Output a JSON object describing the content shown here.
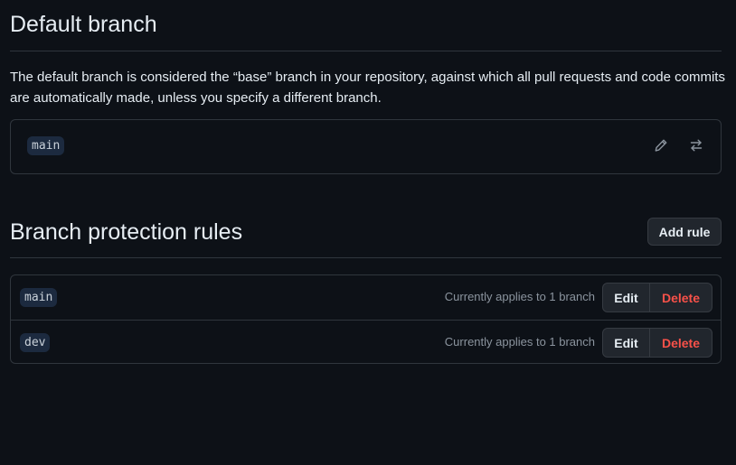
{
  "default_branch": {
    "title": "Default branch",
    "description": "The default branch is considered the “base” branch in your repository, against which all pull requests and code commits are automatically made, unless you specify a different branch.",
    "branch_name": "main",
    "edit_icon": "pencil-icon",
    "switch_icon": "arrow-switch-icon"
  },
  "protection": {
    "title": "Branch protection rules",
    "add_rule_label": "Add rule",
    "rules": [
      {
        "branch": "main",
        "applies_text": "Currently applies to 1 branch",
        "edit_label": "Edit",
        "delete_label": "Delete"
      },
      {
        "branch": "dev",
        "applies_text": "Currently applies to 1 branch",
        "edit_label": "Edit",
        "delete_label": "Delete"
      }
    ]
  },
  "colors": {
    "background": "#0d1117",
    "border": "#30363d",
    "danger": "#f85149",
    "muted_text": "#8b949e"
  }
}
